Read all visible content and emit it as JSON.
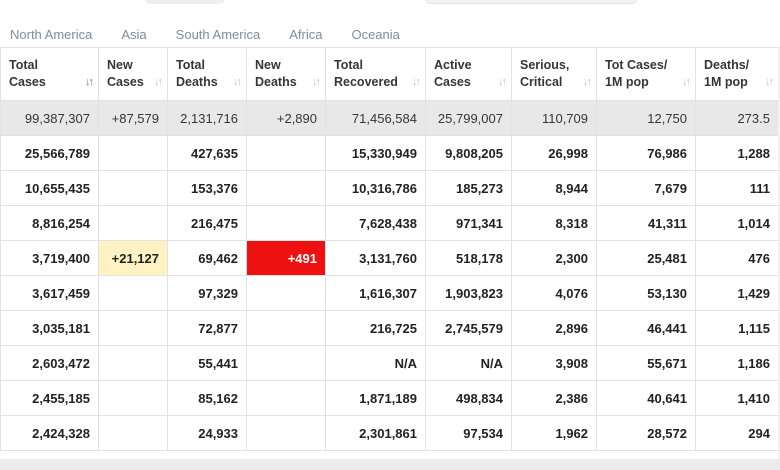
{
  "tabs": [
    {
      "label": "North America"
    },
    {
      "label": "Asia"
    },
    {
      "label": "South America"
    },
    {
      "label": "Africa"
    },
    {
      "label": "Oceania"
    }
  ],
  "headers": [
    {
      "line1": "Total",
      "line2": "Cases"
    },
    {
      "line1": "New",
      "line2": "Cases"
    },
    {
      "line1": "Total",
      "line2": "Deaths"
    },
    {
      "line1": "New",
      "line2": "Deaths"
    },
    {
      "line1": "Total",
      "line2": "Recovered"
    },
    {
      "line1": "Active",
      "line2": "Cases"
    },
    {
      "line1": "Serious,",
      "line2": "Critical"
    },
    {
      "line1": "Tot Cases/",
      "line2": "1M pop"
    },
    {
      "line1": "Deaths/",
      "line2": "1M pop"
    }
  ],
  "total_row": [
    "99,387,307",
    "+87,579",
    "2,131,716",
    "+2,890",
    "71,456,584",
    "25,799,007",
    "110,709",
    "12,750",
    "273.5"
  ],
  "rows": [
    [
      "25,566,789",
      "",
      "427,635",
      "",
      "15,330,949",
      "9,808,205",
      "26,998",
      "76,986",
      "1,288"
    ],
    [
      "10,655,435",
      "",
      "153,376",
      "",
      "10,316,786",
      "185,273",
      "8,944",
      "7,679",
      "111"
    ],
    [
      "8,816,254",
      "",
      "216,475",
      "",
      "7,628,438",
      "971,341",
      "8,318",
      "41,311",
      "1,014"
    ],
    [
      "3,719,400",
      "+21,127",
      "69,462",
      "+491",
      "3,131,760",
      "518,178",
      "2,300",
      "25,481",
      "476"
    ],
    [
      "3,617,459",
      "",
      "97,329",
      "",
      "1,616,307",
      "1,903,823",
      "4,076",
      "53,130",
      "1,429"
    ],
    [
      "3,035,181",
      "",
      "72,877",
      "",
      "216,725",
      "2,745,579",
      "2,896",
      "46,441",
      "1,115"
    ],
    [
      "2,603,472",
      "",
      "55,441",
      "",
      "N/A",
      "N/A",
      "3,908",
      "55,671",
      "1,186"
    ],
    [
      "2,455,185",
      "",
      "85,162",
      "",
      "1,871,189",
      "498,834",
      "2,386",
      "40,641",
      "1,410"
    ],
    [
      "2,424,328",
      "",
      "24,933",
      "",
      "2,301,861",
      "97,534",
      "1,962",
      "28,572",
      "294"
    ]
  ],
  "colors": {
    "tab_text": "#7b8ea0",
    "total_row_bg": "#e8e8e8",
    "new_cases_highlight": "#fff3c4",
    "new_deaths_highlight": "#ee1111"
  },
  "icons": {
    "sort_active": "sort-desc-icon",
    "sort_inactive": "sort-both-icon"
  }
}
